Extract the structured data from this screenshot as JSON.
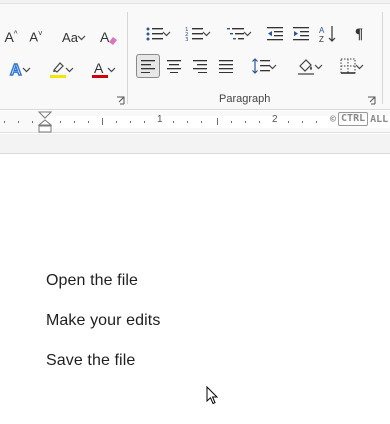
{
  "ribbon": {
    "paragraph_group_label": "Paragraph",
    "font_tools": [
      {
        "icon": "grow-font-icon",
        "label": "A^"
      },
      {
        "icon": "shrink-font-icon",
        "label": "A˅"
      },
      {
        "icon": "change-case-icon",
        "label": "Aa"
      },
      {
        "icon": "clear-formatting-icon",
        "label": "A"
      },
      {
        "icon": "text-effects-icon",
        "label": "A"
      },
      {
        "icon": "highlight-icon",
        "label": ""
      },
      {
        "icon": "font-color-icon",
        "label": "A"
      }
    ],
    "colors": {
      "highlight": "#f3e600",
      "font_color": "#d20000",
      "text_effects": "#2e75d6",
      "accent": "#2b579a"
    },
    "alignment_selected": "align-left"
  },
  "ruler": {
    "labels": [
      "1",
      "2"
    ]
  },
  "badge": {
    "symbol": "©",
    "ctrl": "CTRL",
    "all": "ALL"
  },
  "document": {
    "lines": [
      "Open the file",
      "Make your edits",
      "Save the file"
    ]
  }
}
